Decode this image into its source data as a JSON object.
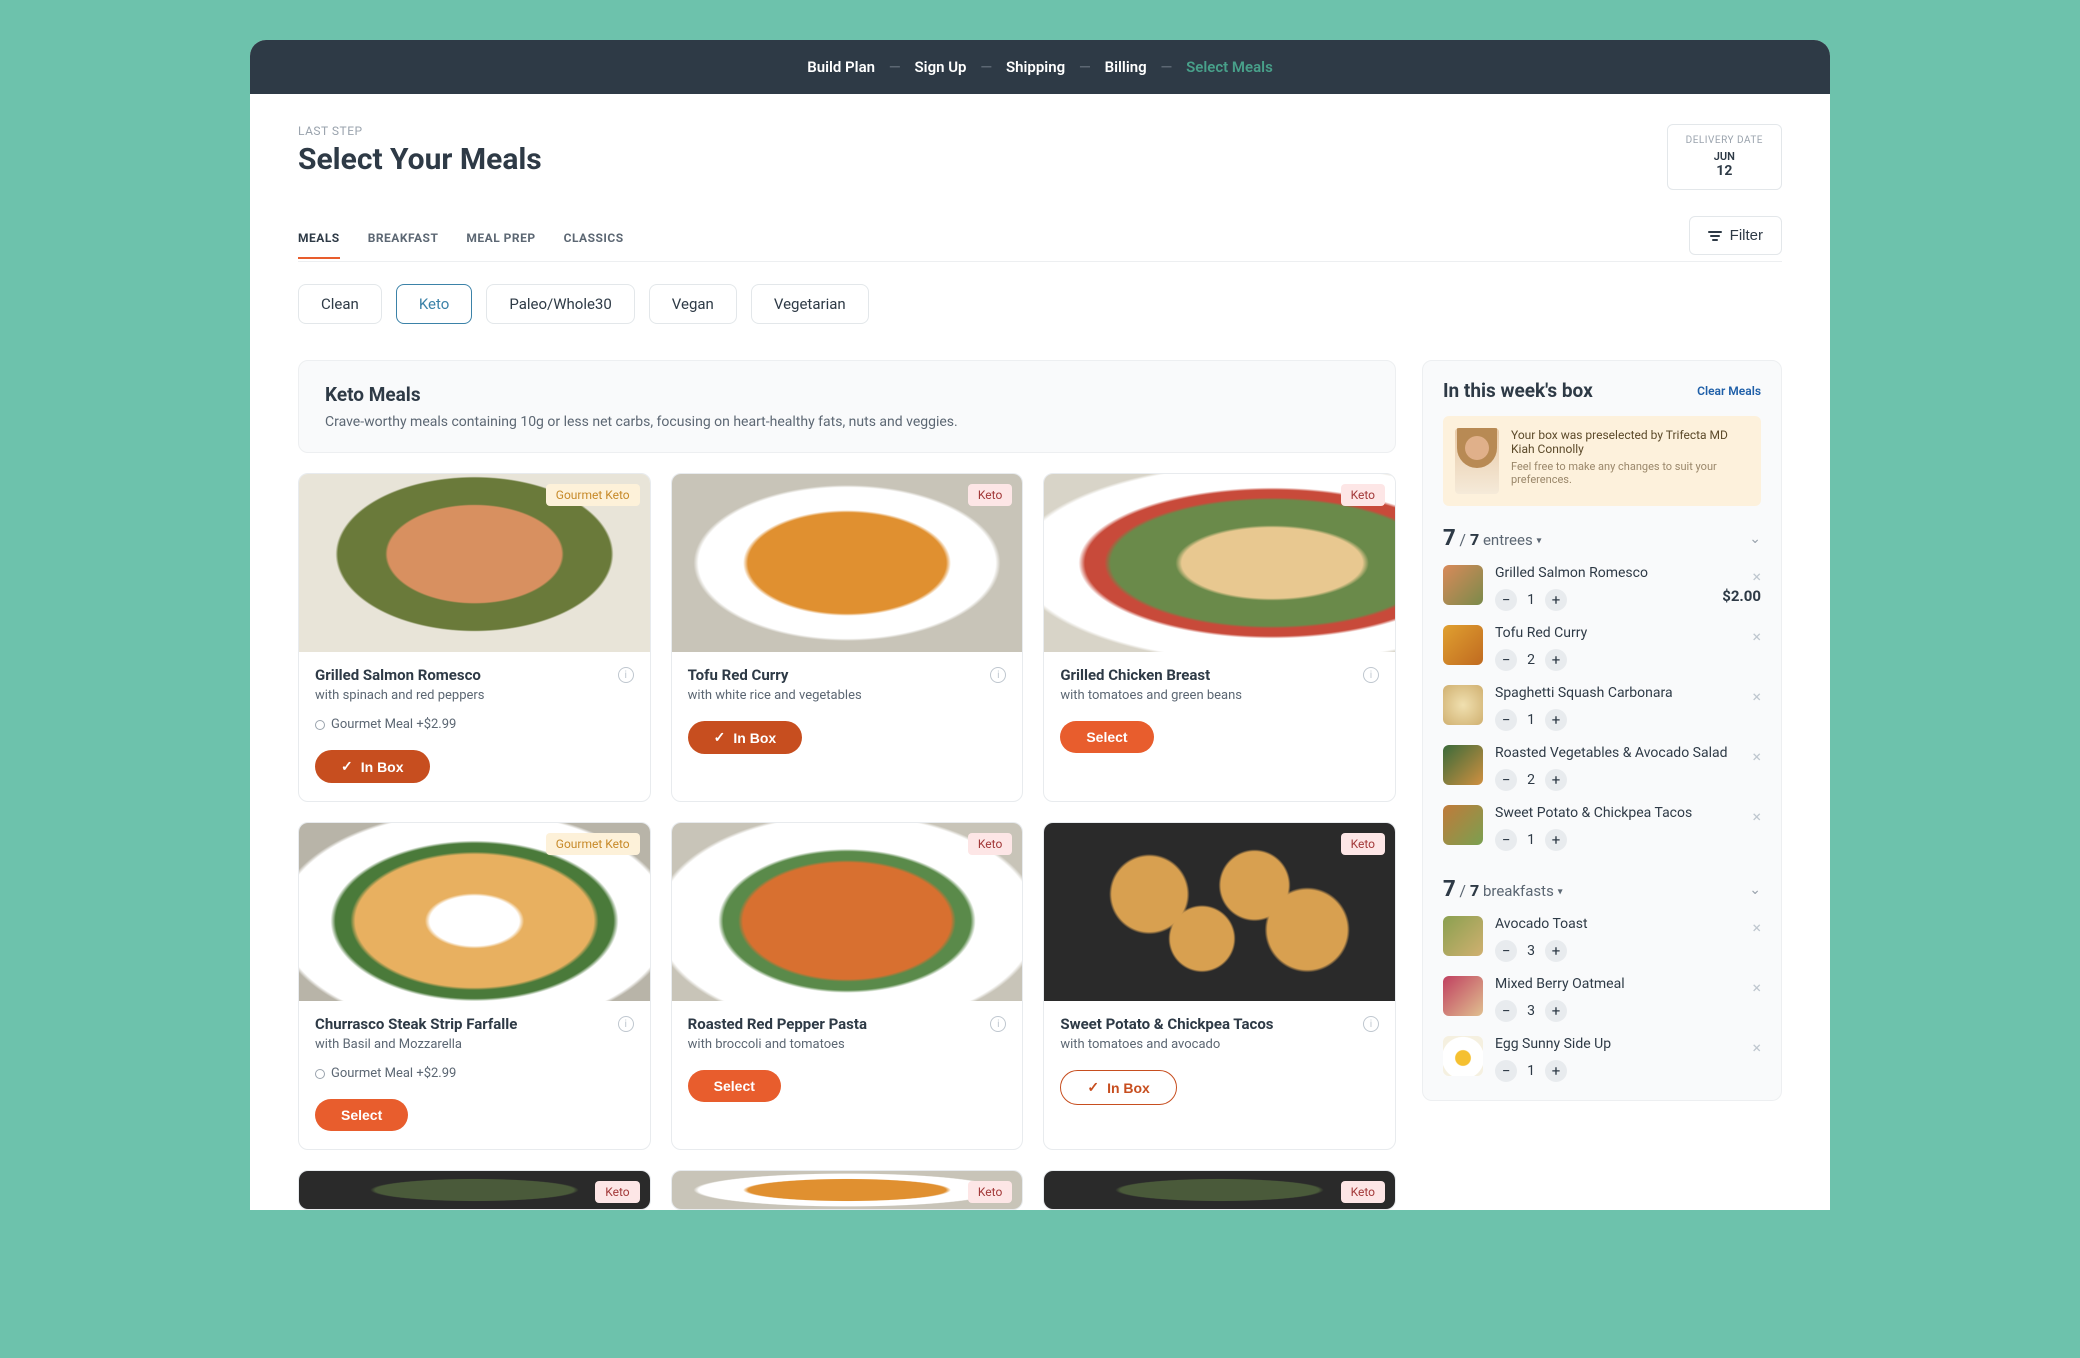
{
  "topbar": {
    "steps": [
      "Build Plan",
      "Sign Up",
      "Shipping",
      "Billing",
      "Select Meals"
    ],
    "active_index": 4
  },
  "header": {
    "kicker": "LAST STEP",
    "title": "Select Your Meals",
    "delivery": {
      "label": "DELIVERY DATE",
      "month": "JUN",
      "day": "12"
    }
  },
  "tabs": {
    "labels": [
      "MEALS",
      "BREAKFAST",
      "MEAL PREP",
      "CLASSICS"
    ],
    "active_index": 0,
    "filter_label": "Filter"
  },
  "diet_pills": {
    "labels": [
      "Clean",
      "Keto",
      "Paleo/Whole30",
      "Vegan",
      "Vegetarian"
    ],
    "active_index": 1
  },
  "section": {
    "title": "Keto Meals",
    "desc": "Crave-worthy meals containing 10g or less net carbs, focusing on heart-healthy fats, nuts and veggies."
  },
  "buttons": {
    "in_box": "In Box",
    "select": "Select"
  },
  "badge_labels": {
    "keto": "Keto",
    "gourmet": "Gourmet Keto"
  },
  "gourmet_line": "Gourmet Meal +$2.99",
  "meals": [
    {
      "title": "Grilled Salmon Romesco",
      "sub": "with spinach and red peppers",
      "badge": "gourmet",
      "gourmet": true,
      "state": "inbox_solid",
      "img": "food-salmon"
    },
    {
      "title": "Tofu Red Curry",
      "sub": "with white rice and vegetables",
      "badge": "keto",
      "gourmet": false,
      "state": "inbox_solid",
      "img": "food-curry"
    },
    {
      "title": "Grilled Chicken Breast",
      "sub": "with tomatoes and green beans",
      "badge": "keto",
      "gourmet": false,
      "state": "select",
      "img": "food-chicken"
    },
    {
      "title": "Churrasco Steak Strip Farfalle",
      "sub": "with Basil and Mozzarella",
      "badge": "gourmet",
      "gourmet": true,
      "state": "select",
      "img": "food-farfalle"
    },
    {
      "title": "Roasted Red Pepper Pasta",
      "sub": "with broccoli and tomatoes",
      "badge": "keto",
      "gourmet": false,
      "state": "select",
      "img": "food-pasta"
    },
    {
      "title": "Sweet Potato & Chickpea Tacos",
      "sub": "with tomatoes and avocado",
      "badge": "keto",
      "gourmet": false,
      "state": "inbox_outline",
      "img": "food-tacos"
    }
  ],
  "peek_meals": [
    {
      "badge": "keto",
      "img": "food-dark"
    },
    {
      "badge": "keto",
      "img": "food-curry"
    },
    {
      "badge": "keto",
      "img": "food-dark"
    }
  ],
  "sidebar": {
    "title": "In this week's box",
    "clear": "Clear Meals",
    "preselect_main": "Your box was preselected by Trifecta MD Kiah Connolly",
    "preselect_sub": "Feel free to make any changes to suit your preferences.",
    "entrees": {
      "count": 7,
      "total": 7,
      "label": "entrees",
      "items": [
        {
          "name": "Grilled Salmon Romesco",
          "qty": 1,
          "price": "$2.00",
          "thumb": "salmon"
        },
        {
          "name": "Tofu Red Curry",
          "qty": 2,
          "thumb": "curry"
        },
        {
          "name": "Spaghetti Squash Carbonara",
          "qty": 1,
          "thumb": "carbonara"
        },
        {
          "name": "Roasted Vegetables & Avocado Salad",
          "qty": 2,
          "thumb": "veg"
        },
        {
          "name": "Sweet Potato & Chickpea Tacos",
          "qty": 1,
          "thumb": "tacos"
        }
      ]
    },
    "breakfasts": {
      "count": 7,
      "total": 7,
      "label": "breakfasts",
      "items": [
        {
          "name": "Avocado Toast",
          "qty": 3,
          "thumb": "toast"
        },
        {
          "name": "Mixed Berry Oatmeal",
          "qty": 3,
          "thumb": "oatmeal"
        },
        {
          "name": "Egg Sunny Side Up",
          "qty": 1,
          "thumb": "egg"
        }
      ]
    }
  }
}
